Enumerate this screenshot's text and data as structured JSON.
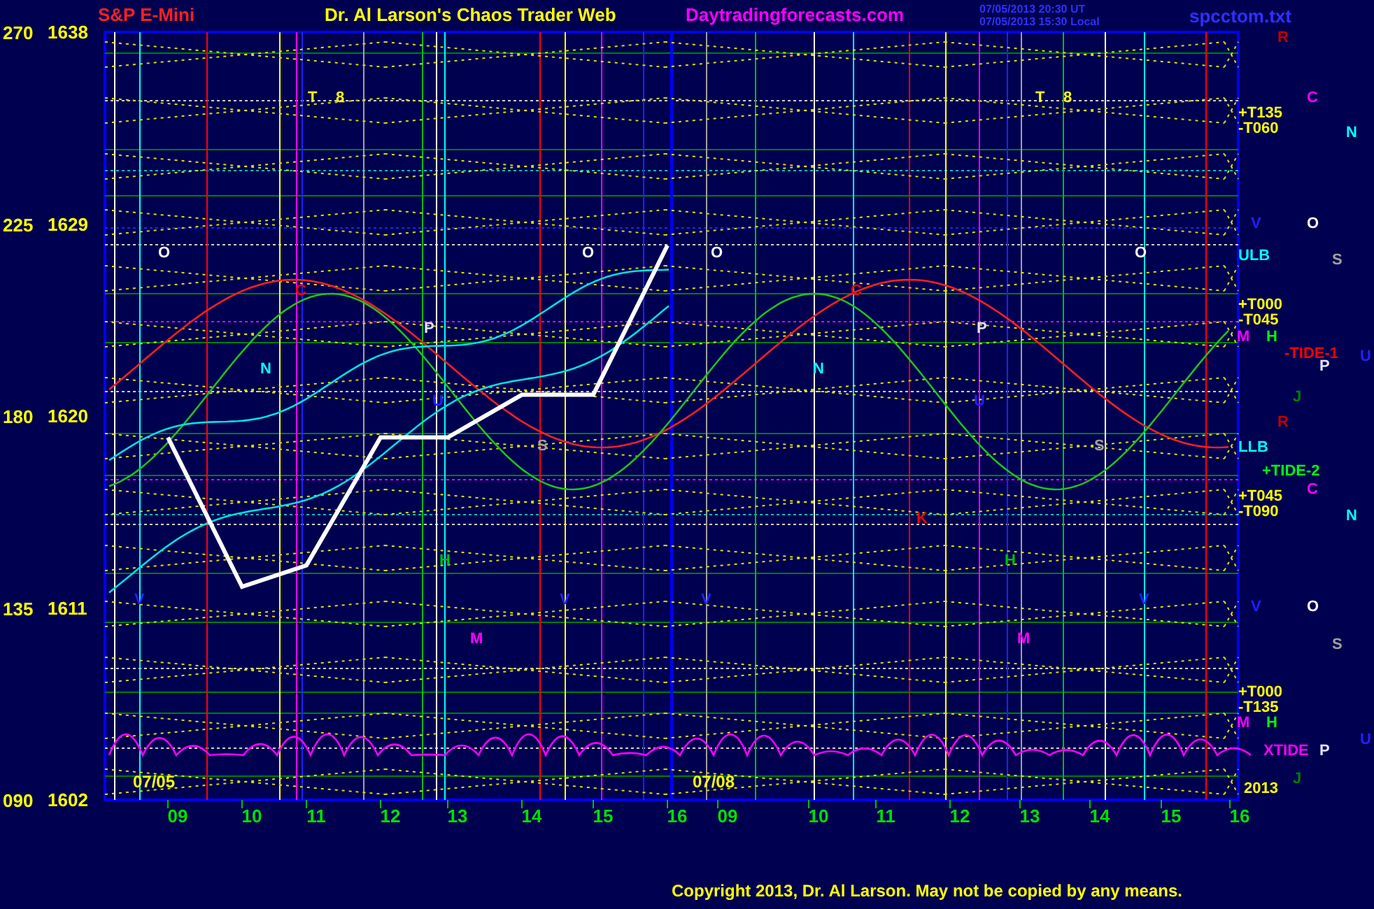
{
  "header": {
    "author": "Dr. Al Larson's Chaos Trader Web",
    "site": "Daytradingforecasts.com",
    "timestamp_ut": "07/05/2013 20:30 UT",
    "timestamp_local": "07/05/2013 15:30 Local",
    "file": "spcctom.txt"
  },
  "y_axis": [
    "270",
    "225",
    "180",
    "135",
    "090"
  ],
  "chart": {
    "dates": [
      "07/05",
      "07/08"
    ],
    "chart_data": {
      "type": "line",
      "categories": [
        "09",
        "10",
        "11",
        "12",
        "13",
        "14",
        "15",
        "16",
        "09",
        "10",
        "11",
        "12",
        "13",
        "14",
        "15",
        "16"
      ],
      "ylim": [
        1602,
        1638
      ],
      "grid": true,
      "yticks": [
        {
          "value": 1638,
          "label": "1638"
        },
        {
          "value": 1629,
          "label": "1629"
        },
        {
          "value": 1620,
          "label": "1620"
        },
        {
          "value": 1611,
          "label": "1611"
        },
        {
          "value": 1602,
          "label": "1602"
        }
      ],
      "series": [
        {
          "name": "S&P E-Mini",
          "color": "#ffffff",
          "values": [
            1619,
            1612,
            1613,
            1619,
            1619,
            1621,
            1621,
            1628,
            null,
            null,
            null,
            null,
            null,
            null,
            null,
            null
          ]
        }
      ]
    },
    "markers": [
      {
        "text": "T",
        "color": "#ffff00"
      },
      {
        "text": "8",
        "color": "#ffff00"
      },
      {
        "text": "T",
        "color": "#ffff00"
      },
      {
        "text": "8",
        "color": "#ffff00"
      },
      {
        "text": "O",
        "color": "#ffffff"
      },
      {
        "text": "O",
        "color": "#ffffff"
      },
      {
        "text": "O",
        "color": "#ffffff"
      },
      {
        "text": "O",
        "color": "#ffffff"
      },
      {
        "text": "C",
        "color": "#ff0000"
      },
      {
        "text": "C",
        "color": "#ff0000"
      },
      {
        "text": "N",
        "color": "#00ffff"
      },
      {
        "text": "N",
        "color": "#00ffff"
      },
      {
        "text": "P",
        "color": "#e0e0ff"
      },
      {
        "text": "P",
        "color": "#e0e0ff"
      },
      {
        "text": "S",
        "color": "#a0a0a0"
      },
      {
        "text": "S",
        "color": "#a0a0a0"
      },
      {
        "text": "H",
        "color": "#00c000"
      },
      {
        "text": "H",
        "color": "#00c000"
      },
      {
        "text": "V",
        "color": "#2020ff"
      },
      {
        "text": "V",
        "color": "#2020ff"
      },
      {
        "text": "V",
        "color": "#2020ff"
      },
      {
        "text": "V",
        "color": "#2020ff"
      },
      {
        "text": "M",
        "color": "#ff00ff"
      },
      {
        "text": "M",
        "color": "#ff00ff"
      },
      {
        "text": "K",
        "color": "#ff0000"
      },
      {
        "text": "U",
        "color": "#2020ff"
      },
      {
        "text": "U",
        "color": "#2020ff"
      }
    ]
  },
  "right_labels": [
    {
      "text": "R",
      "color": "#c00000"
    },
    {
      "text": "C",
      "color": "#ff00ff"
    },
    {
      "text": "+T135",
      "color": "#ffff00"
    },
    {
      "text": "-T060",
      "color": "#ffff00"
    },
    {
      "text": "N",
      "color": "#00ffff"
    },
    {
      "text": "V",
      "color": "#2020ff"
    },
    {
      "text": "O",
      "color": "#ffffff"
    },
    {
      "text": "ULB",
      "color": "#00ffff"
    },
    {
      "text": "S",
      "color": "#a0a0a0"
    },
    {
      "text": "+T000",
      "color": "#ffff00"
    },
    {
      "text": "-T045",
      "color": "#ffff00"
    },
    {
      "text": "M",
      "color": "#ff00ff"
    },
    {
      "text": "H",
      "color": "#00ff00"
    },
    {
      "text": "-TIDE-1",
      "color": "#ff0000"
    },
    {
      "text": "U",
      "color": "#2020ff"
    },
    {
      "text": "P",
      "color": "#e0e0ff"
    },
    {
      "text": "J",
      "color": "#008000"
    },
    {
      "text": "R",
      "color": "#c00000"
    },
    {
      "text": "LLB",
      "color": "#00ffff"
    },
    {
      "text": "+TIDE-2",
      "color": "#00ff00"
    },
    {
      "text": "C",
      "color": "#ff00ff"
    },
    {
      "text": "+T045",
      "color": "#ffff00"
    },
    {
      "text": "-T090",
      "color": "#ffff00"
    },
    {
      "text": "N",
      "color": "#00ffff"
    },
    {
      "text": "V",
      "color": "#2020ff"
    },
    {
      "text": "O",
      "color": "#ffffff"
    },
    {
      "text": "S",
      "color": "#a0a0a0"
    },
    {
      "text": "+T000",
      "color": "#ffff00"
    },
    {
      "text": "-T135",
      "color": "#ffff00"
    },
    {
      "text": "M",
      "color": "#ff00ff"
    },
    {
      "text": "H",
      "color": "#00ff00"
    },
    {
      "text": "U",
      "color": "#2020ff"
    },
    {
      "text": "XTIDE",
      "color": "#ff00ff"
    },
    {
      "text": "P",
      "color": "#e0e0ff"
    },
    {
      "text": "J",
      "color": "#008000"
    },
    {
      "text": "2013",
      "color": "#ffff00"
    }
  ],
  "copyright": "Copyright 2013, Dr. Al Larson. May not be copied by any means."
}
